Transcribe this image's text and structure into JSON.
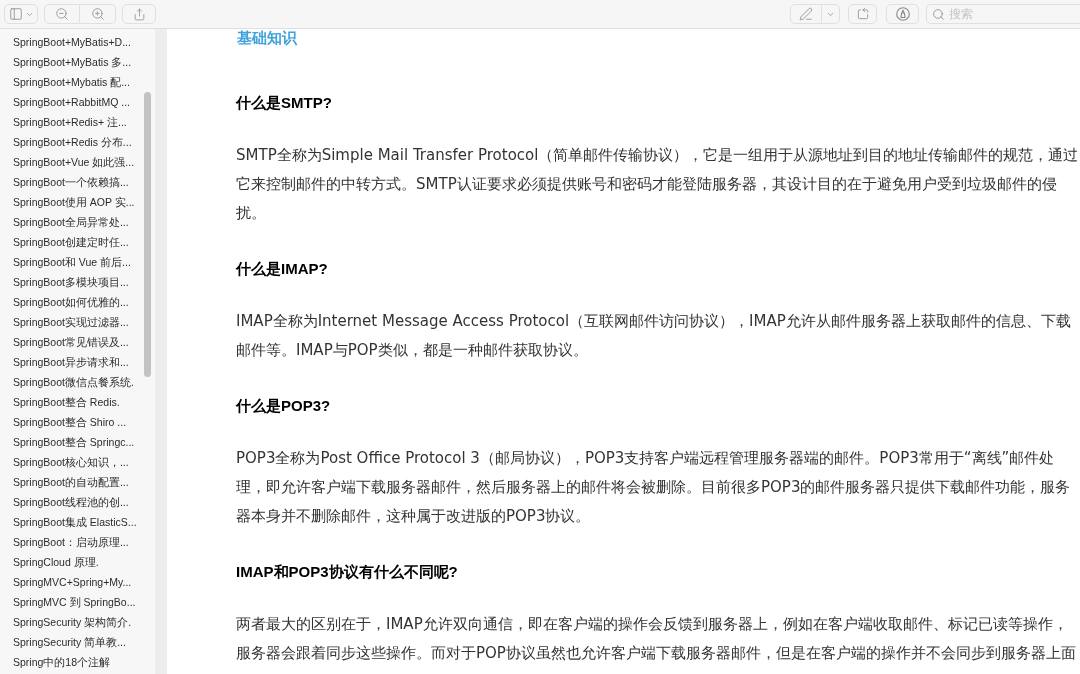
{
  "toolbar": {
    "search": {
      "placeholder": "搜索"
    }
  },
  "sidebar": {
    "items": [
      "SpringBoot+MyBatis+D...",
      "SpringBoot+MyBatis 多...",
      "SpringBoot+Mybatis 配...",
      "SpringBoot+RabbitMQ ...",
      "SpringBoot+Redis+ 注...",
      "SpringBoot+Redis 分布...",
      "SpringBoot+Vue 如此强...",
      "SpringBoot一个依赖搞...",
      "SpringBoot使用 AOP 实...",
      "SpringBoot全局异常处...",
      "SpringBoot创建定时任...",
      "SpringBoot和 Vue 前后...",
      "SpringBoot多模块项目...",
      "SpringBoot如何优雅的...",
      "SpringBoot实现过滤器...",
      "SpringBoot常见错误及...",
      "SpringBoot异步请求和...",
      "SpringBoot微信点餐系统.",
      "SpringBoot整合 Redis.",
      "SpringBoot整合 Shiro ...",
      "SpringBoot整合 Springc...",
      "SpringBoot核心知识，...",
      "SpringBoot的自动配置...",
      "SpringBoot线程池的创...",
      "SpringBoot集成 ElasticS...",
      "SpringBoot：启动原理...",
      "SpringCloud 原理.",
      "SpringMVC+Spring+My...",
      "SpringMVC 到 SpringBo...",
      "SpringSecurity 架构简介.",
      "SpringSecurity 简单教...",
      "Spring中的18个注解"
    ]
  },
  "document": {
    "section_title": "基础知识",
    "blocks": [
      {
        "kind": "heading",
        "text": "什么是SMTP?"
      },
      {
        "kind": "paragraph",
        "text": "SMTP全称为Simple Mail Transfer Protocol（简单邮件传输协议），它是一组用于从源地址到目的地址传输邮件的规范，通过它来控制邮件的中转方式。SMTP认证要求必须提供账号和密码才能登陆服务器，其设计目的在于避免用户受到垃圾邮件的侵扰。"
      },
      {
        "kind": "heading",
        "text": "什么是IMAP?"
      },
      {
        "kind": "paragraph",
        "text": "IMAP全称为Internet Message Access Protocol（互联网邮件访问协议），IMAP允许从邮件服务器上获取邮件的信息、下载邮件等。IMAP与POP类似，都是一种邮件获取协议。"
      },
      {
        "kind": "heading",
        "text": "什么是POP3?"
      },
      {
        "kind": "paragraph",
        "text": "POP3全称为Post Office Protocol 3（邮局协议），POP3支持客户端远程管理服务器端的邮件。POP3常用于“离线”邮件处理，即允许客户端下载服务器邮件，然后服务器上的邮件将会被删除。目前很多POP3的邮件服务器只提供下载邮件功能，服务器本身并不删除邮件，这种属于改进版的POP3协议。"
      },
      {
        "kind": "heading",
        "text": "IMAP和POP3协议有什么不同呢?"
      },
      {
        "kind": "paragraph",
        "text": "两者最大的区别在于，IMAP允许双向通信，即在客户端的操作会反馈到服务器上，例如在客户端收取邮件、标记已读等操作，服务器会跟着同步这些操作。而对于POP协议虽然也允许客户端下载服务器邮件，但是在客户端的操作并不会同步到服务器上面"
      }
    ]
  }
}
